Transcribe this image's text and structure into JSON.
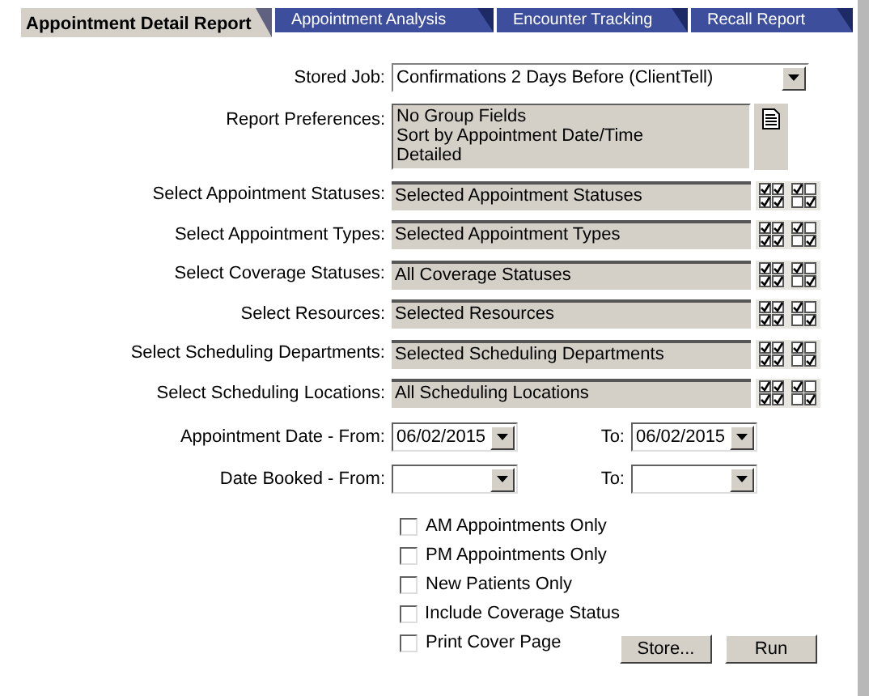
{
  "tabs": [
    {
      "label": "Appointment Detail Report",
      "selected": true
    },
    {
      "label": "Appointment Analysis",
      "selected": false
    },
    {
      "label": "Encounter Tracking",
      "selected": false
    },
    {
      "label": "Recall Report",
      "selected": false
    }
  ],
  "stored_job": {
    "label": "Stored Job:",
    "value": "Confirmations 2 Days Before (ClientTell)"
  },
  "report_preferences": {
    "label": "Report Preferences:",
    "lines": [
      "No Group Fields",
      "Sort by Appointment Date/Time",
      "Detailed"
    ]
  },
  "selectors": [
    {
      "label": "Select Appointment Statuses:",
      "value": "Selected Appointment Statuses"
    },
    {
      "label": "Select Appointment Types:",
      "value": "Selected Appointment Types"
    },
    {
      "label": "Select Coverage Statuses:",
      "value": "All Coverage Statuses"
    },
    {
      "label": "Select Resources:",
      "value": "Selected Resources"
    },
    {
      "label": "Select Scheduling Departments:",
      "value": "Selected Scheduling Departments"
    },
    {
      "label": "Select Scheduling Locations:",
      "value": "All Scheduling Locations"
    }
  ],
  "date_ranges": [
    {
      "label": "Appointment Date - From:",
      "from": "06/02/2015",
      "to_label": "To:",
      "to": "06/02/2015"
    },
    {
      "label": "Date Booked - From:",
      "to_label": "To:"
    }
  ],
  "options": [
    {
      "label": "AM Appointments Only",
      "checked": false
    },
    {
      "label": "PM Appointments Only",
      "checked": false
    },
    {
      "label": "New Patients Only",
      "checked": false
    },
    {
      "label": "Include Coverage Status",
      "checked": false
    },
    {
      "label": "Print Cover Page",
      "checked": false
    }
  ],
  "buttons": [
    "Store...",
    "Run"
  ]
}
